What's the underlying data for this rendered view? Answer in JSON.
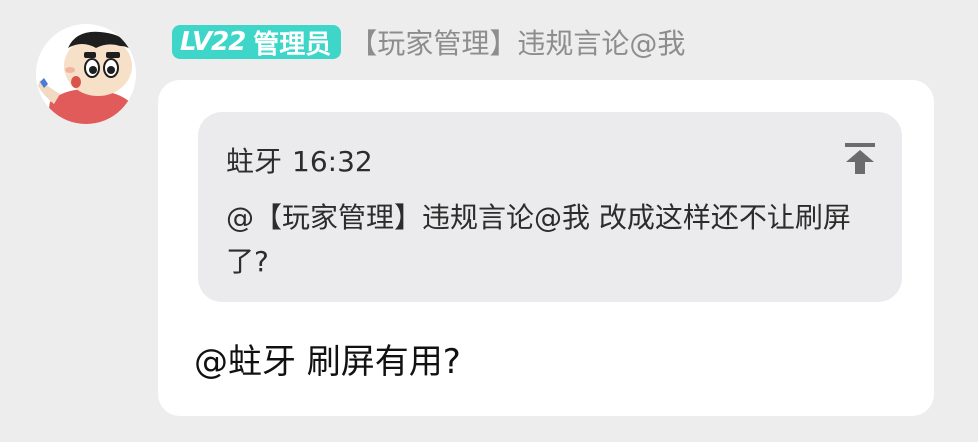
{
  "message": {
    "sender": {
      "level_badge": "LV22",
      "role": "管理员",
      "name": "【玩家管理】违规言论@我",
      "avatar_icon": "cartoon-boy-avatar"
    },
    "quote": {
      "author": "蛀牙",
      "time": "16:32",
      "text": "@【玩家管理】违规言论@我 改成这样还不让刷屏了?",
      "jump_icon": "jump-to-top-icon"
    },
    "reply": "@蛀牙 刷屏有用?"
  },
  "colors": {
    "background": "#ededed",
    "badge": "#3ed6c8",
    "bubble": "#ffffff",
    "quote_bg": "#ebebed",
    "sender_name": "#8d8d8d"
  }
}
